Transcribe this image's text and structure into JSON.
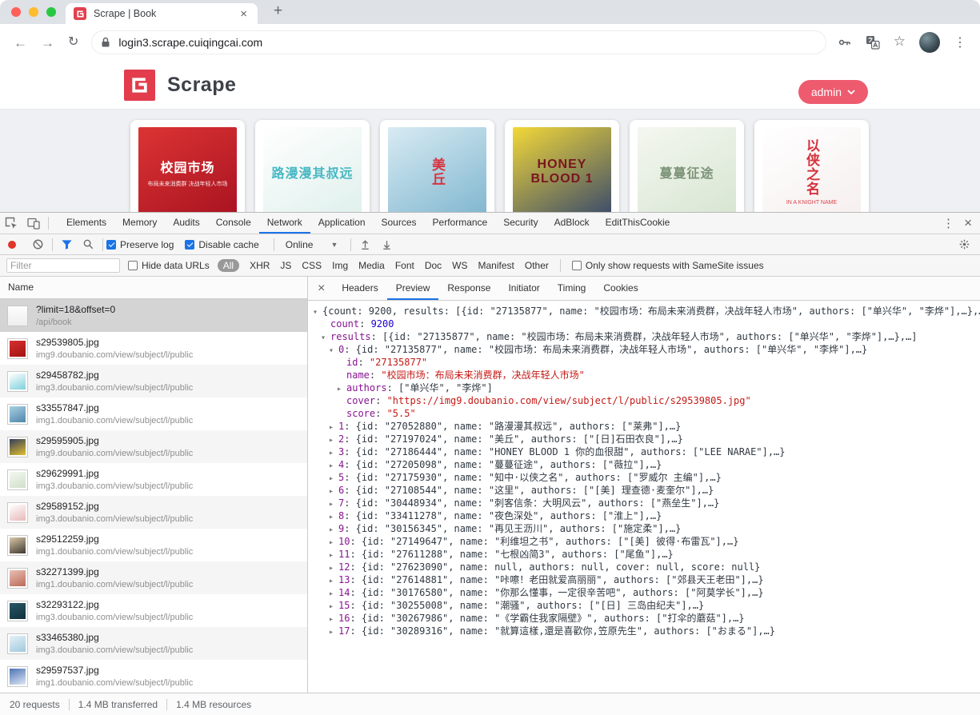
{
  "browser": {
    "tab_title": "Scrape | Book",
    "url": "login3.scrape.cuiqingcai.com",
    "new_tab_label": "+"
  },
  "site_header": {
    "brand": "Scrape",
    "user_button": "admin",
    "brand_color": "#e23c4d",
    "button_color": "#ee5b6e"
  },
  "covers": [
    {
      "title": "校园市场",
      "subtitle": "布局未来消费群 决战年轻人市场",
      "colors": [
        "#dc3434",
        "#a81320"
      ],
      "text_color": "#ffffff",
      "vertical": false
    },
    {
      "title": "路漫漫其叔远",
      "subtitle": "",
      "colors": [
        "#ffffff",
        "#dff0ec"
      ],
      "text_color": "#49b8c4",
      "vertical": false
    },
    {
      "title": "美丘",
      "subtitle": "",
      "colors": [
        "#d8ebf3",
        "#7fb6cf"
      ],
      "text_color": "#d8333f",
      "vertical": true
    },
    {
      "title": "HONEY BLOOD 1",
      "subtitle": "",
      "colors": [
        "#f3d838",
        "#394a6b"
      ],
      "text_color": "#7a1420",
      "vertical": false
    },
    {
      "title": "蔓蔓征途",
      "subtitle": "",
      "colors": [
        "#f4f7f0",
        "#d7e5d2"
      ],
      "text_color": "#7d9478",
      "vertical": false
    },
    {
      "title": "以侠之名",
      "subtitle": "IN A KNIGHT NAME",
      "colors": [
        "#ffffff",
        "#f6efef"
      ],
      "text_color": "#d5323c",
      "vertical": true
    }
  ],
  "devtools": {
    "tabs": [
      "Elements",
      "Memory",
      "Audits",
      "Console",
      "Network",
      "Application",
      "Sources",
      "Performance",
      "Security",
      "AdBlock",
      "EditThisCookie"
    ],
    "active_tab": "Network",
    "toolbar": {
      "preserve_log": "Preserve log",
      "disable_cache": "Disable cache",
      "throttling": "Online"
    },
    "filter": {
      "placeholder": "Filter",
      "hide_data_urls": "Hide data URLs",
      "types": [
        "All",
        "XHR",
        "JS",
        "CSS",
        "Img",
        "Media",
        "Font",
        "Doc",
        "WS",
        "Manifest",
        "Other"
      ],
      "active_type": "All",
      "samesite": "Only show requests with SameSite issues"
    },
    "requests_header": "Name",
    "requests": [
      {
        "name": "?limit=18&offset=0",
        "path": "/api/book",
        "selected": true,
        "thumb": "doc"
      },
      {
        "name": "s29539805.jpg",
        "path": "img9.doubanio.com/view/subject/l/public",
        "thumb": [
          "#d83030",
          "#a31212"
        ]
      },
      {
        "name": "s29458782.jpg",
        "path": "img3.doubanio.com/view/subject/l/public",
        "thumb": [
          "#ffffff",
          "#7fd0dc"
        ]
      },
      {
        "name": "s33557847.jpg",
        "path": "img1.doubanio.com/view/subject/l/public",
        "thumb": [
          "#a9cfe2",
          "#4f87ab"
        ]
      },
      {
        "name": "s29595905.jpg",
        "path": "img9.doubanio.com/view/subject/l/public",
        "thumb": [
          "#323d5c",
          "#e3bf2e"
        ]
      },
      {
        "name": "s29629991.jpg",
        "path": "img3.doubanio.com/view/subject/l/public",
        "thumb": [
          "#f4f7f0",
          "#cfe0c8"
        ]
      },
      {
        "name": "s29589152.jpg",
        "path": "img3.doubanio.com/view/subject/l/public",
        "thumb": [
          "#ffffff",
          "#e8b9b9"
        ]
      },
      {
        "name": "s29512259.jpg",
        "path": "img1.doubanio.com/view/subject/l/public",
        "thumb": [
          "#d9c8a9",
          "#3f3830"
        ]
      },
      {
        "name": "s32271399.jpg",
        "path": "img1.doubanio.com/view/subject/l/public",
        "thumb": [
          "#e8c0b4",
          "#bb6a58"
        ]
      },
      {
        "name": "s32293122.jpg",
        "path": "img3.doubanio.com/view/subject/l/public",
        "thumb": [
          "#2a5766",
          "#10303c"
        ]
      },
      {
        "name": "s33465380.jpg",
        "path": "img3.doubanio.com/view/subject/l/public",
        "thumb": [
          "#e6f1f7",
          "#9ec9dd"
        ]
      },
      {
        "name": "s29597537.jpg",
        "path": "img1.doubanio.com/view/subject/l/public",
        "thumb": [
          "#4d73b5",
          "#dfe8f3"
        ]
      }
    ],
    "detail_tabs": [
      "Headers",
      "Preview",
      "Response",
      "Initiator",
      "Timing",
      "Cookies"
    ],
    "active_detail_tab": "Preview",
    "preview_lines": [
      {
        "ind": 0,
        "a": "▾",
        "parts": [
          [
            "p",
            "{count: 9200, results: [{id: \"27135877\", name: \"校园市场：布局未来消费群，决战年轻人市场\", authors: [\"单兴华\", \"李烨\"],…},…"
          ]
        ]
      },
      {
        "ind": 1,
        "a": "",
        "parts": [
          [
            "k",
            "count"
          ],
          [
            "p",
            ": "
          ],
          [
            "n",
            "9200"
          ]
        ]
      },
      {
        "ind": 1,
        "a": "▾",
        "parts": [
          [
            "k",
            "results"
          ],
          [
            "p",
            ": [{id: \"27135877\", name: \"校园市场：布局未来消费群，决战年轻人市场\", authors: [\"单兴华\", \"李烨\"],…},…]"
          ]
        ]
      },
      {
        "ind": 2,
        "a": "▾",
        "parts": [
          [
            "k",
            "0"
          ],
          [
            "p",
            ": {id: \"27135877\", name: \"校园市场：布局未来消费群，决战年轻人市场\", authors: [\"单兴华\", \"李烨\"],…}"
          ]
        ]
      },
      {
        "ind": 3,
        "a": "",
        "parts": [
          [
            "k",
            "id"
          ],
          [
            "p",
            ": "
          ],
          [
            "s",
            "\"27135877\""
          ]
        ]
      },
      {
        "ind": 3,
        "a": "",
        "parts": [
          [
            "k",
            "name"
          ],
          [
            "p",
            ": "
          ],
          [
            "s",
            "\"校园市场：布局未来消费群，决战年轻人市场\""
          ]
        ]
      },
      {
        "ind": 3,
        "a": "▸",
        "parts": [
          [
            "k",
            "authors"
          ],
          [
            "p",
            ": [\"单兴华\", \"李烨\"]"
          ]
        ]
      },
      {
        "ind": 3,
        "a": "",
        "parts": [
          [
            "k",
            "cover"
          ],
          [
            "p",
            ": "
          ],
          [
            "s",
            "\"https://img9.doubanio.com/view/subject/l/public/s29539805.jpg\""
          ]
        ]
      },
      {
        "ind": 3,
        "a": "",
        "parts": [
          [
            "k",
            "score"
          ],
          [
            "p",
            ": "
          ],
          [
            "s",
            "\"5.5\""
          ]
        ]
      },
      {
        "ind": 2,
        "a": "▸",
        "parts": [
          [
            "k",
            "1"
          ],
          [
            "p",
            ": {id: \"27052880\", name: \"路漫漫其叔远\", authors: [\"莱弗\"],…}"
          ]
        ]
      },
      {
        "ind": 2,
        "a": "▸",
        "parts": [
          [
            "k",
            "2"
          ],
          [
            "p",
            ": {id: \"27197024\", name: \"美丘\", authors: [\"[日]石田衣良\"],…}"
          ]
        ]
      },
      {
        "ind": 2,
        "a": "▸",
        "parts": [
          [
            "k",
            "3"
          ],
          [
            "p",
            ": {id: \"27186444\", name: \"HONEY BLOOD 1 你的血很甜\", authors: [\"LEE NARAE\"],…}"
          ]
        ]
      },
      {
        "ind": 2,
        "a": "▸",
        "parts": [
          [
            "k",
            "4"
          ],
          [
            "p",
            ": {id: \"27205098\", name: \"蔓蔓征途\", authors: [\"薇拉\"],…}"
          ]
        ]
      },
      {
        "ind": 2,
        "a": "▸",
        "parts": [
          [
            "k",
            "5"
          ],
          [
            "p",
            ": {id: \"27175930\", name: \"知中·以侠之名\", authors: [\"罗威尔 主编\"],…}"
          ]
        ]
      },
      {
        "ind": 2,
        "a": "▸",
        "parts": [
          [
            "k",
            "6"
          ],
          [
            "p",
            ": {id: \"27108544\", name: \"这里\", authors: [\"[美] 理查德·麦奎尔\"],…}"
          ]
        ]
      },
      {
        "ind": 2,
        "a": "▸",
        "parts": [
          [
            "k",
            "7"
          ],
          [
            "p",
            ": {id: \"30448934\", name: \"刺客信条：大明风云\", authors: [\"燕垒生\"],…}"
          ]
        ]
      },
      {
        "ind": 2,
        "a": "▸",
        "parts": [
          [
            "k",
            "8"
          ],
          [
            "p",
            ": {id: \"33411278\", name: \"夜色深处\", authors: [\"淮上\"],…}"
          ]
        ]
      },
      {
        "ind": 2,
        "a": "▸",
        "parts": [
          [
            "k",
            "9"
          ],
          [
            "p",
            ": {id: \"30156345\", name: \"再见王沥川\", authors: [\"施定柔\"],…}"
          ]
        ]
      },
      {
        "ind": 2,
        "a": "▸",
        "parts": [
          [
            "k",
            "10"
          ],
          [
            "p",
            ": {id: \"27149647\", name: \"利维坦之书\", authors: [\"[美] 彼得·布雷瓦\"],…}"
          ]
        ]
      },
      {
        "ind": 2,
        "a": "▸",
        "parts": [
          [
            "k",
            "11"
          ],
          [
            "p",
            ": {id: \"27611288\", name: \"七根凶简3\", authors: [\"尾鱼\"],…}"
          ]
        ]
      },
      {
        "ind": 2,
        "a": "▸",
        "parts": [
          [
            "k",
            "12"
          ],
          [
            "p",
            ": {id: \"27623090\", name: null, authors: null, cover: null, score: null}"
          ]
        ]
      },
      {
        "ind": 2,
        "a": "▸",
        "parts": [
          [
            "k",
            "13"
          ],
          [
            "p",
            ": {id: \"27614881\", name: \"咔嚓！老田就爱高丽丽\", authors: [\"郊县天王老田\"],…}"
          ]
        ]
      },
      {
        "ind": 2,
        "a": "▸",
        "parts": [
          [
            "k",
            "14"
          ],
          [
            "p",
            ": {id: \"30176580\", name: \"你那么懂事，一定很辛苦吧\", authors: [\"阿莫学长\"],…}"
          ]
        ]
      },
      {
        "ind": 2,
        "a": "▸",
        "parts": [
          [
            "k",
            "15"
          ],
          [
            "p",
            ": {id: \"30255008\", name: \"潮骚\", authors: [\"[日] 三岛由纪夫\"],…}"
          ]
        ]
      },
      {
        "ind": 2,
        "a": "▸",
        "parts": [
          [
            "k",
            "16"
          ],
          [
            "p",
            ": {id: \"30267986\", name: \"《学霸住我家隔壁》\", authors: [\"打伞的蘑菇\"],…}"
          ]
        ]
      },
      {
        "ind": 2,
        "a": "▸",
        "parts": [
          [
            "k",
            "17"
          ],
          [
            "p",
            ": {id: \"30289316\", name: \"就算這樣,還是喜歡你,笠原先生\", authors: [\"おまる\"],…}"
          ]
        ]
      }
    ],
    "status": [
      "20 requests",
      "1.4 MB transferred",
      "1.4 MB resources"
    ]
  }
}
